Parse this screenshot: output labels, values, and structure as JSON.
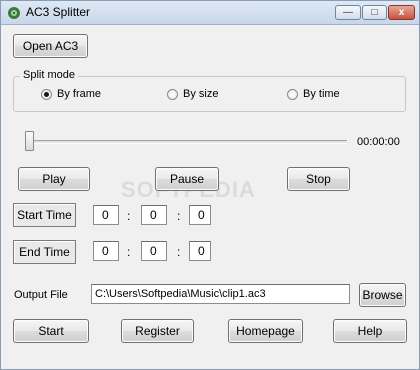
{
  "window": {
    "title": "AC3 Splitter",
    "minimize_glyph": "—",
    "maximize_glyph": "□",
    "close_glyph": "x"
  },
  "toolbar": {
    "open_label": "Open AC3"
  },
  "split_mode": {
    "label": "Split mode",
    "options": [
      {
        "label": "By frame",
        "checked": true
      },
      {
        "label": "By size",
        "checked": false
      },
      {
        "label": "By time",
        "checked": false
      }
    ]
  },
  "playback": {
    "position": 0,
    "time_display": "00:00:00",
    "play_label": "Play",
    "pause_label": "Pause",
    "stop_label": "Stop"
  },
  "start_time": {
    "button_label": "Start Time",
    "h": "0",
    "m": "0",
    "s": "0"
  },
  "end_time": {
    "button_label": "End Time",
    "h": "0",
    "m": "0",
    "s": "0"
  },
  "colon": ":",
  "output": {
    "label": "Output File",
    "path": "C:\\Users\\Softpedia\\Music\\clip1.ac3",
    "browse_label": "Browse"
  },
  "footer": {
    "start_label": "Start",
    "register_label": "Register",
    "homepage_label": "Homepage",
    "help_label": "Help"
  },
  "watermark": "SOFTPEDIA"
}
